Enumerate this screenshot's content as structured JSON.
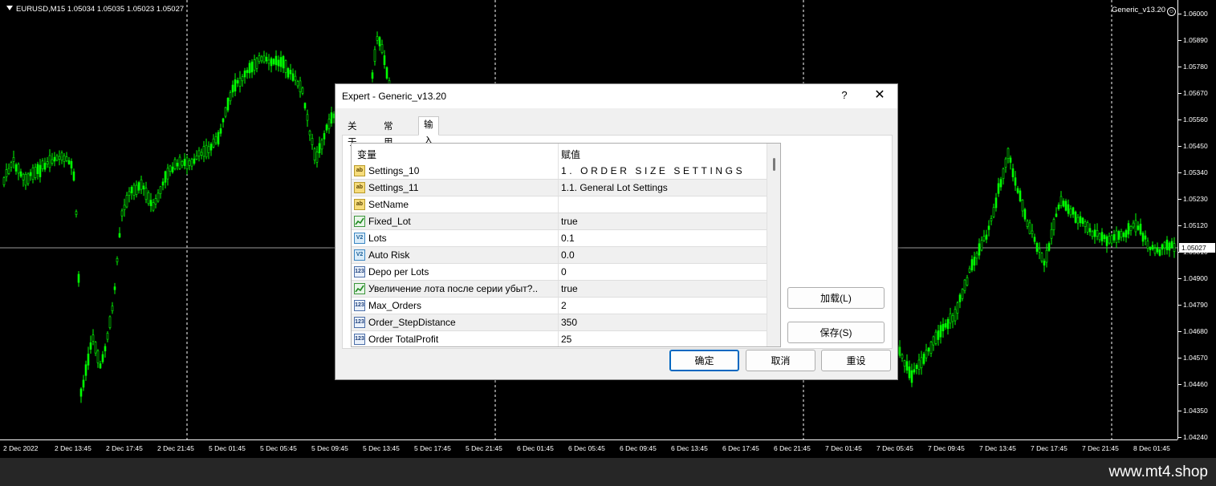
{
  "chart": {
    "symbol_line": "EURUSD,M15  1.05034 1.05035 1.05023 1.05027",
    "ea_label": "Generic_v13.20",
    "smiley": "☺",
    "current_price": "1.05027",
    "price_ticks": [
      "1.06000",
      "1.05890",
      "1.05780",
      "1.05670",
      "1.05560",
      "1.05450",
      "1.05340",
      "1.05230",
      "1.05120",
      "1.05010",
      "1.04900",
      "1.04790",
      "1.04680",
      "1.04570",
      "1.04460",
      "1.04350",
      "1.04240"
    ],
    "time_ticks": [
      "2 Dec 2022",
      "2 Dec 13:45",
      "2 Dec 17:45",
      "2 Dec 21:45",
      "5 Dec 01:45",
      "5 Dec 05:45",
      "5 Dec 09:45",
      "5 Dec 13:45",
      "5 Dec 17:45",
      "5 Dec 21:45",
      "6 Dec 01:45",
      "6 Dec 05:45",
      "6 Dec 09:45",
      "6 Dec 13:45",
      "6 Dec 17:45",
      "6 Dec 21:45",
      "7 Dec 01:45",
      "7 Dec 05:45",
      "7 Dec 09:45",
      "7 Dec 13:45",
      "7 Dec 17:45",
      "7 Dec 21:45",
      "8 Dec 01:45"
    ],
    "candle_color": "#00ff00",
    "background_color": "#000000"
  },
  "footer": {
    "site": "www.mt4.shop"
  },
  "dialog": {
    "title": "Expert - Generic_v13.20",
    "help_label": "?",
    "close_label": "✕",
    "tabs": [
      {
        "label": "关于",
        "active": false
      },
      {
        "label": "常用",
        "active": false
      },
      {
        "label": "输入参数",
        "active": true
      }
    ],
    "table": {
      "col_variable": "变量",
      "col_value": "赋值",
      "rows": [
        {
          "icon": "string",
          "name": "Settings_10",
          "value": "1. ORDER SIZE SETTINGS"
        },
        {
          "icon": "string",
          "name": "Settings_11",
          "value": " 1.1. General Lot Settings"
        },
        {
          "icon": "string",
          "name": "SetName",
          "value": ""
        },
        {
          "icon": "bool",
          "name": "Fixed_Lot",
          "value": "true"
        },
        {
          "icon": "double",
          "name": "Lots",
          "value": "0.1"
        },
        {
          "icon": "double",
          "name": "Auto Risk",
          "value": "0.0"
        },
        {
          "icon": "int",
          "name": "Depo per Lots",
          "value": "0"
        },
        {
          "icon": "bool",
          "name": "Увеличение лота после серии убыт?..",
          "value": "true"
        },
        {
          "icon": "int",
          "name": "Max_Orders",
          "value": "2"
        },
        {
          "icon": "int",
          "name": "Order_StepDistance",
          "value": "350"
        },
        {
          "icon": "int",
          "name": "Order TotalProfit",
          "value": "25"
        }
      ]
    },
    "buttons": {
      "load": "加载(L)",
      "save": "保存(S)",
      "ok": "确定",
      "cancel": "取消",
      "reset": "重设"
    }
  }
}
